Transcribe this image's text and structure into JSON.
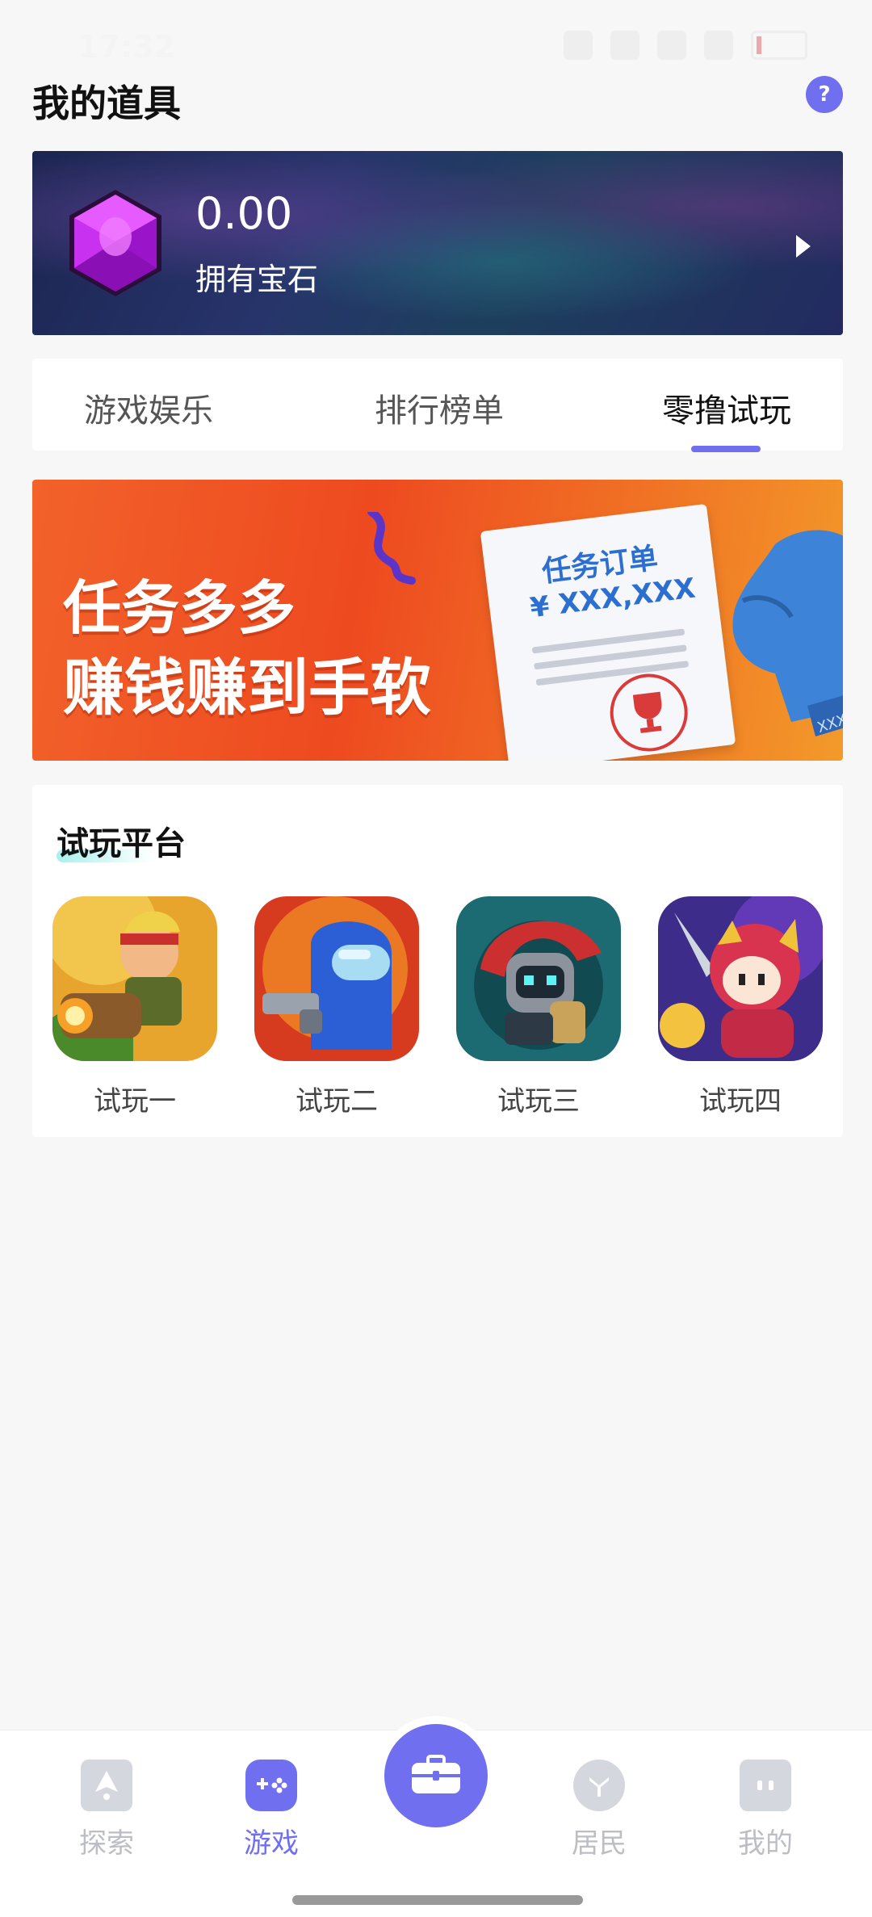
{
  "status_bar": {
    "time": "17:32",
    "battery": "6"
  },
  "header": {
    "title": "我的道具",
    "help_label": "?"
  },
  "gem_card": {
    "value": "0.00",
    "label": "拥有宝石"
  },
  "tabs": [
    {
      "label": "游戏娱乐",
      "active": false
    },
    {
      "label": "排行榜单",
      "active": false
    },
    {
      "label": "零撸试玩",
      "active": true
    }
  ],
  "banner": {
    "line1": "任务多多",
    "line2": "赚钱赚到手软",
    "order_title": "任务订单",
    "order_amount": "¥ XXX,XXX",
    "order_corner": "XXXX"
  },
  "trial_panel": {
    "title": "试玩平台",
    "games": [
      {
        "label": "试玩一",
        "icon": "soldier-game-icon"
      },
      {
        "label": "试玩二",
        "icon": "astronaut-game-icon"
      },
      {
        "label": "试玩三",
        "icon": "knight-robot-game-icon"
      },
      {
        "label": "试玩四",
        "icon": "warrior-girl-game-icon"
      }
    ]
  },
  "bottom_nav": [
    {
      "label": "探索",
      "icon": "explore-icon",
      "active": false
    },
    {
      "label": "游戏",
      "icon": "gamepad-icon",
      "active": true
    },
    {
      "label": "",
      "icon": "toolbox-icon",
      "active": false
    },
    {
      "label": "居民",
      "icon": "resident-icon",
      "active": false
    },
    {
      "label": "我的",
      "icon": "profile-icon",
      "active": false
    }
  ],
  "colors": {
    "accent": "#6f6ff0",
    "background": "#f7f7f8",
    "banner": "#ee4a20"
  }
}
